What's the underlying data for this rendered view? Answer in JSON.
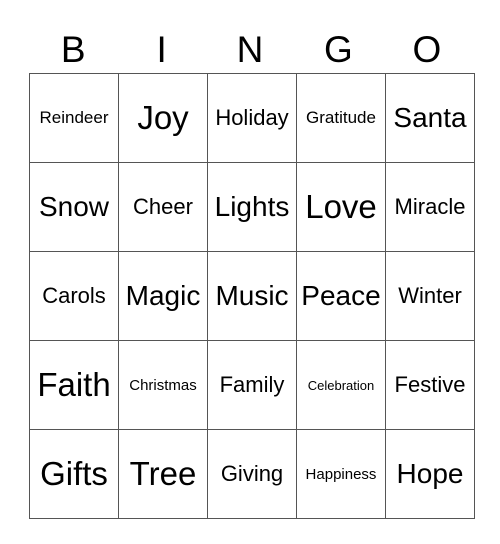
{
  "header": [
    "B",
    "I",
    "N",
    "G",
    "O"
  ],
  "rows": [
    [
      {
        "text": "Reindeer",
        "size": "s-s"
      },
      {
        "text": "Joy",
        "size": "s-xl"
      },
      {
        "text": "Holiday",
        "size": "s-m"
      },
      {
        "text": "Gratitude",
        "size": "s-s"
      },
      {
        "text": "Santa",
        "size": "s-l"
      }
    ],
    [
      {
        "text": "Snow",
        "size": "s-l"
      },
      {
        "text": "Cheer",
        "size": "s-m"
      },
      {
        "text": "Lights",
        "size": "s-l"
      },
      {
        "text": "Love",
        "size": "s-xl"
      },
      {
        "text": "Miracle",
        "size": "s-m"
      }
    ],
    [
      {
        "text": "Carols",
        "size": "s-m"
      },
      {
        "text": "Magic",
        "size": "s-l"
      },
      {
        "text": "Music",
        "size": "s-l"
      },
      {
        "text": "Peace",
        "size": "s-l"
      },
      {
        "text": "Winter",
        "size": "s-m"
      }
    ],
    [
      {
        "text": "Faith",
        "size": "s-xl"
      },
      {
        "text": "Christmas",
        "size": "s-xs"
      },
      {
        "text": "Family",
        "size": "s-m"
      },
      {
        "text": "Celebration",
        "size": "s-xxs"
      },
      {
        "text": "Festive",
        "size": "s-m"
      }
    ],
    [
      {
        "text": "Gifts",
        "size": "s-xl"
      },
      {
        "text": "Tree",
        "size": "s-xl"
      },
      {
        "text": "Giving",
        "size": "s-m"
      },
      {
        "text": "Happiness",
        "size": "s-xs"
      },
      {
        "text": "Hope",
        "size": "s-l"
      }
    ]
  ]
}
